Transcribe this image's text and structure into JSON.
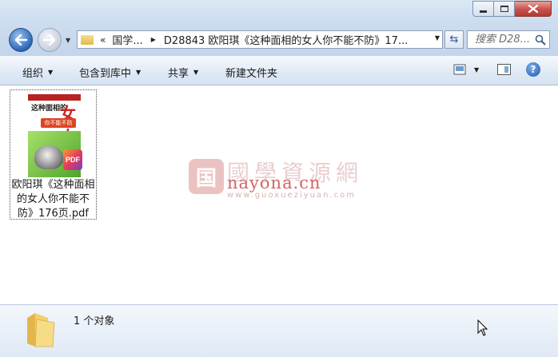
{
  "window": {
    "controls": {
      "minimize": "minimize",
      "maximize": "maximize",
      "close": "close"
    }
  },
  "nav": {
    "back_label": "back",
    "forward_label": "forward"
  },
  "address": {
    "overflow": "«",
    "crumb1": "国学...",
    "crumb2": "D28843 欧阳琪《这种面相的女人你不能不防》17..."
  },
  "search": {
    "placeholder": "搜索 D28..."
  },
  "toolbar": {
    "organize": "组织",
    "include_in_library": "包含到库中",
    "share": "共享",
    "new_folder": "新建文件夹"
  },
  "file": {
    "name": "欧阳琪《这种面相的女人你不能不防》176页.pdf",
    "badge": "PDF",
    "cover_title": "这种面相的",
    "cover_big": "女人",
    "cover_tag": "你不能不防"
  },
  "watermark": {
    "logo": "国",
    "title": "國學資源網",
    "domain": "nayona.cn",
    "url": "www.guoxueziyuan.com"
  },
  "details": {
    "count": "1 个对象"
  },
  "colors": {
    "accent": "#2a66b8",
    "window_chrome": "#cddcee",
    "close_red": "#c75050"
  }
}
